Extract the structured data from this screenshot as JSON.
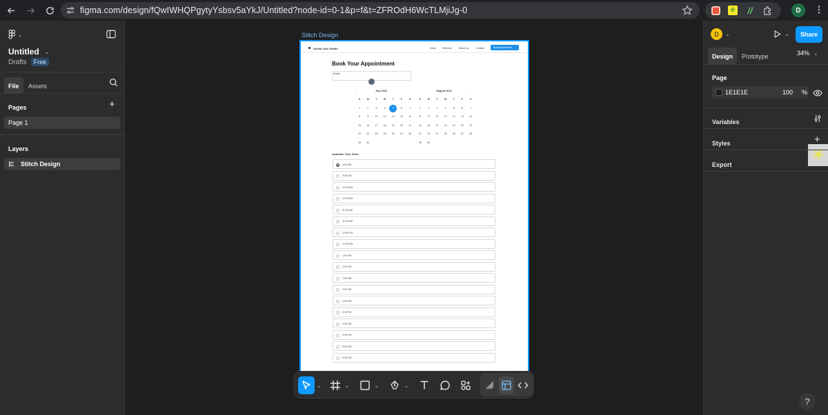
{
  "browser": {
    "url": "figma.com/design/fQwIWHQPgytyYsbsv5aYkJ/Untitled?node-id=0-1&p=f&t=ZFROdH6WcTLMjiJg-0",
    "profile_initial": "D"
  },
  "left_panel": {
    "file_name": "Untitled",
    "location": "Drafts",
    "plan_badge": "Free",
    "tabs": [
      {
        "label": "File"
      },
      {
        "label": "Assets"
      }
    ],
    "pages_heading": "Pages",
    "pages": [
      {
        "label": "Page 1"
      }
    ],
    "layers_heading": "Layers",
    "layers": [
      {
        "label": "Stitch Design"
      }
    ]
  },
  "canvas": {
    "frame_label": "Stitch Design",
    "site": {
      "brand": "Dental Care Studio",
      "nav": [
        "Home",
        "Services",
        "About Us",
        "Contact"
      ],
      "cta": "Book Appointment",
      "title": "Book Your Appointment",
      "select_label": "Select",
      "july": {
        "title": "July 2024",
        "weekdays": [
          "S",
          "M",
          "T",
          "W",
          "T",
          "F",
          "S"
        ],
        "weeks": [
          [
            "1",
            "2",
            "3",
            "4",
            "5",
            "6",
            "7"
          ],
          [
            "8",
            "9",
            "10",
            "11",
            "12",
            "13",
            "14"
          ],
          [
            "15",
            "16",
            "17",
            "18",
            "19",
            "20",
            "21"
          ],
          [
            "22",
            "23",
            "24",
            "25",
            "26",
            "27",
            "28"
          ],
          [
            "29",
            "30",
            "",
            "",
            "",
            "",
            ""
          ]
        ],
        "selected": "5"
      },
      "august": {
        "title": "August 2024",
        "weekdays": [
          "S",
          "M",
          "T",
          "W",
          "T",
          "F",
          "S"
        ],
        "weeks": [
          [
            "1",
            "2",
            "3",
            "4",
            "5",
            "6",
            "7"
          ],
          [
            "8",
            "9",
            "10",
            "11",
            "12",
            "13",
            "14"
          ],
          [
            "15",
            "16",
            "17",
            "18",
            "19",
            "20",
            "21"
          ],
          [
            "22",
            "23",
            "24",
            "25",
            "26",
            "27",
            "28"
          ],
          [
            "29",
            "30",
            "",
            "",
            "",
            "",
            ""
          ]
        ]
      },
      "slots_heading": "Available Time Slots",
      "slots": [
        "9:00 AM",
        "9:30 AM",
        "10:00 AM",
        "10:30 AM",
        "11:00 AM",
        "11:30 AM",
        "12:00 PM",
        "12:30 PM",
        "1:00 PM",
        "1:30 PM",
        "2:00 PM",
        "2:30 PM",
        "3:00 PM",
        "3:30 PM",
        "4:00 PM",
        "4:30 PM",
        "5:00 PM",
        "5:30 PM"
      ]
    }
  },
  "right_panel": {
    "avatar_initial": "D",
    "share_label": "Share",
    "tabs": [
      {
        "label": "Design"
      },
      {
        "label": "Prototype"
      }
    ],
    "zoom": "34%",
    "page_heading": "Page",
    "page_color": "1E1E1E",
    "page_opacity": "100",
    "percent_sign": "%",
    "variables_label": "Variables",
    "styles_label": "Styles",
    "export_label": "Export"
  },
  "colors": {
    "accent": "#0d99ff",
    "canvas_bg": "#1e1e1e",
    "panel_bg": "#2c2c2c"
  }
}
